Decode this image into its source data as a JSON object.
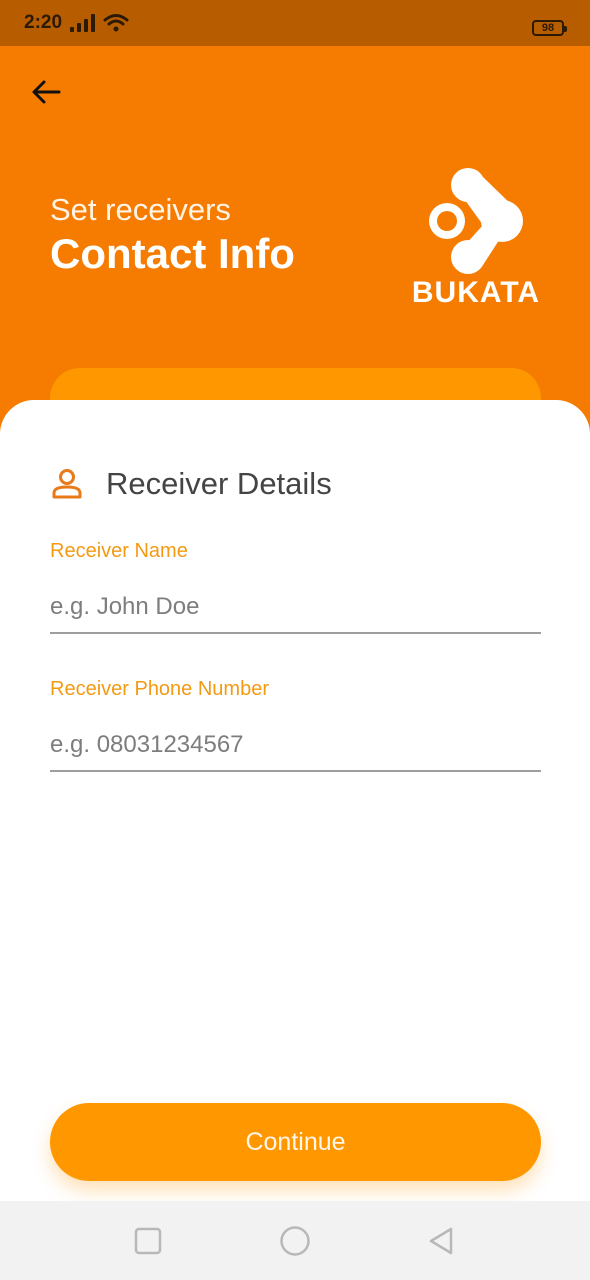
{
  "status_bar": {
    "time": "2:20",
    "battery": "98"
  },
  "header": {
    "subtitle": "Set receivers",
    "title": "Contact Info",
    "logo_text": "BUKATA"
  },
  "section": {
    "title": "Receiver Details",
    "icon": "person-icon"
  },
  "fields": {
    "name": {
      "label": "Receiver Name",
      "placeholder": "e.g. John Doe",
      "value": ""
    },
    "phone": {
      "label": "Receiver Phone Number",
      "placeholder": "e.g. 08031234567",
      "value": ""
    }
  },
  "actions": {
    "continue_label": "Continue"
  },
  "colors": {
    "primary": "#f57c00",
    "accent": "#ff9800",
    "label": "#f39a13",
    "status_bar": "#b85c00"
  }
}
